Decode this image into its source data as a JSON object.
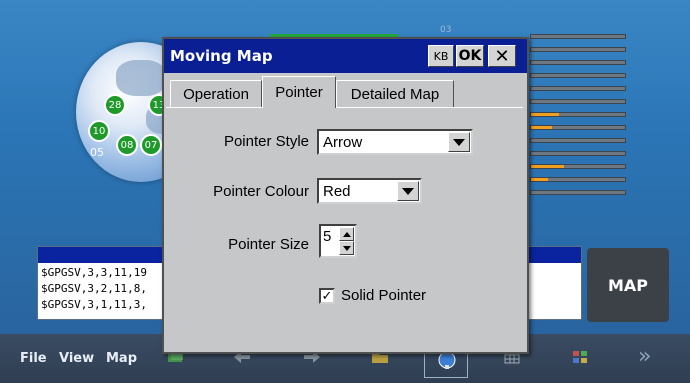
{
  "dialog": {
    "title": "Moving Map",
    "kb_label": "KB",
    "ok_label": "OK",
    "close_label": "✕",
    "tabs": [
      {
        "label": "Operation"
      },
      {
        "label": "Pointer"
      },
      {
        "label": "Detailed Map"
      }
    ],
    "active_tab": "Pointer",
    "pointer_style": {
      "label": "Pointer Style",
      "value": "Arrow"
    },
    "pointer_colour": {
      "label": "Pointer Colour",
      "value": "Red"
    },
    "pointer_size": {
      "label": "Pointer Size",
      "value": "5"
    },
    "solid_pointer": {
      "label": "Solid Pointer",
      "checked": true,
      "check_glyph": "✓"
    }
  },
  "satellites": [
    "28",
    "10",
    "05",
    "08",
    "07",
    "13"
  ],
  "bars": {
    "top_label": "03",
    "levels": [
      0,
      0,
      0,
      0,
      0,
      0,
      0.3,
      0.22,
      0,
      0,
      0.35,
      0.18,
      0
    ]
  },
  "nmea": {
    "lines": [
      "$GPGSV,3,3,11,19",
      "$GPGSV,3,2,11,8,",
      "$GPGSV,3,1,11,3,"
    ]
  },
  "map_button": {
    "label": "MAP"
  },
  "taskbar": {
    "menus": [
      "File",
      "View",
      "Map"
    ],
    "chevron": "»"
  },
  "colors": {
    "title_bar": "#0a1f93",
    "dialog_bg": "#c5c7c9",
    "satellite": "#1f9a2a",
    "signal_fill": "#f0a020",
    "taskbar": "#2f3e52"
  }
}
